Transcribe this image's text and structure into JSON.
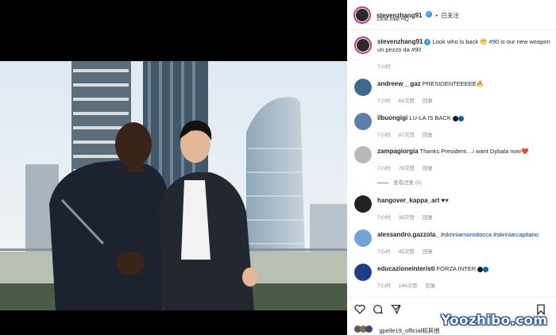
{
  "post": {
    "author": "stevenzhang91",
    "follow_label": "已关注",
    "location": "1908 Inter HQ",
    "caption_prefix": "Look who is back ",
    "caption_emoji": "😁",
    "caption_tag1": "#90",
    "caption_mid": " is our new weapon",
    "caption_line2_prefix": "un pezzo da ",
    "caption_tag2": "#90",
    "caption_time": "7小时"
  },
  "comments": [
    {
      "user": "andreew__gaz",
      "text": "PRESIDENTEEEEE🔥",
      "time": "7小时",
      "likes": "84次赞",
      "reply": "回复",
      "avatar_color": "#3b6b8c"
    },
    {
      "user": "ilbuongigi",
      "text": "LU-LA IS BACK",
      "time": "7小时",
      "likes": "87次赞",
      "reply": "回复",
      "avatar_color": "#5a7fa8"
    },
    {
      "user": "zampagiorgia",
      "text": "Thanks President....i want Dybala now❤️",
      "time": "7小时",
      "likes": "76次赞",
      "reply": "回复",
      "avatar_color": "#b9b9b9",
      "view_replies": "查看回复 (5)"
    },
    {
      "user": "hangover_kappa_art",
      "text": "",
      "time": "7小时",
      "likes": "38次赞",
      "reply": "回复",
      "avatar_color": "#222222"
    },
    {
      "user": "alessandro.gazzola_",
      "text": "#skriniarnonsitocca #skriniarcapitano",
      "time": "7小时",
      "likes": "45次赞",
      "reply": "回复",
      "avatar_color": "#6fa4d6"
    },
    {
      "user": "educazioneinteristi",
      "text": "FORZA INTER",
      "time": "7小时",
      "likes": "146次赞",
      "reply": "回复",
      "avatar_color": "#1d3f8a"
    }
  ],
  "liked_by": "gpelle19_official和其他",
  "watermark": "Yoozhibo.com",
  "colors": {
    "inter_black": "#1b1b1b",
    "inter_blue": "#0068a8",
    "link": "#00376b",
    "verified": "#3897f0"
  },
  "icons": [
    "heart-icon",
    "comment-icon",
    "share-icon",
    "bookmark-icon",
    "verified-icon"
  ]
}
